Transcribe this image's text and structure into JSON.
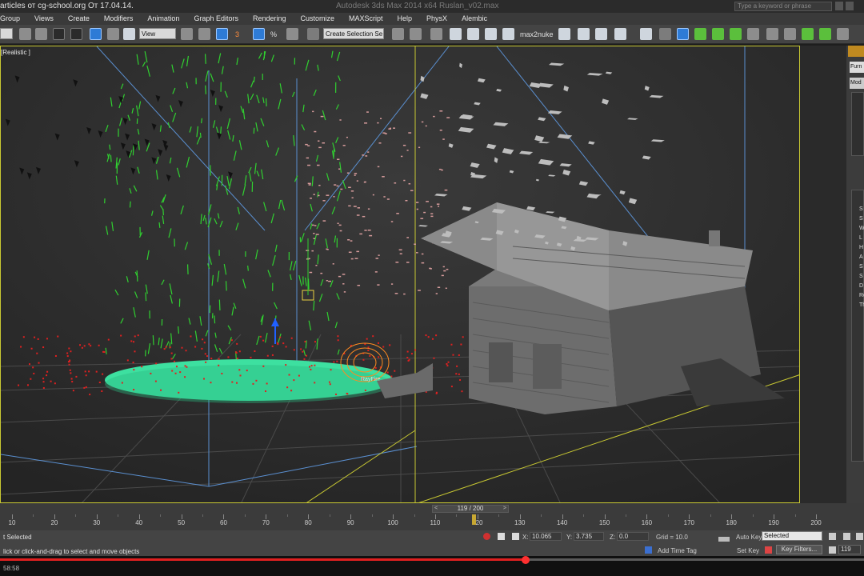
{
  "titlebar": {
    "source_text": "articles от cg-school.org  От 17.04.14.",
    "window_title": "Autodesk 3ds Max 2014 x64   Ruslan_v02.max",
    "search_placeholder": "Type a keyword or phrase"
  },
  "menu": [
    "Group",
    "Views",
    "Create",
    "Modifiers",
    "Animation",
    "Graph Editors",
    "Rendering",
    "Customize",
    "MAXScript",
    "Help",
    "PhysX",
    "Alembic"
  ],
  "toolbar": {
    "view_dropdown": "View",
    "selection_set": "Create Selection Se",
    "max2nuke_label": "max2nuke",
    "snap_label": "3",
    "percent_label": "%"
  },
  "viewport": {
    "label": "[Realistic ]",
    "object_label": "RayFire"
  },
  "right_panel": {
    "tab1": "Furn",
    "tab2": "Mod",
    "side_letters": [
      "S",
      "S",
      "W",
      "L",
      "H",
      "A",
      "S",
      "S",
      "D",
      "Re",
      "Th"
    ]
  },
  "timeline": {
    "frame_display": "119 / 200",
    "current_frame": 119,
    "total_frames": 200,
    "ticks": [
      10,
      20,
      30,
      40,
      50,
      60,
      70,
      80,
      90,
      100,
      110,
      120,
      130,
      140,
      150,
      160,
      170,
      180,
      190,
      200
    ]
  },
  "status": {
    "selection": "t Selected",
    "hint": "lick or click-and-drag to select and move objects",
    "x_value": "10.065",
    "y_value": "3.735",
    "z_value": "0.0",
    "x_label": "X:",
    "y_label": "Y:",
    "z_label": "Z:",
    "grid": "Grid = 10.0",
    "add_time_tag": "Add Time Tag",
    "auto_key": "Auto Key",
    "set_key": "Set Key",
    "selected_dropdown": "Selected",
    "key_filters": "Key Filters...",
    "frame_field": "119"
  },
  "player": {
    "time": "58:58",
    "progress": 0.608
  },
  "colors": {
    "viewport_border": "#c8c832",
    "ground_disc": "#3de0a0",
    "particles_green": "#30d030",
    "particles_red": "#e02020",
    "progress_red": "#e02020"
  }
}
